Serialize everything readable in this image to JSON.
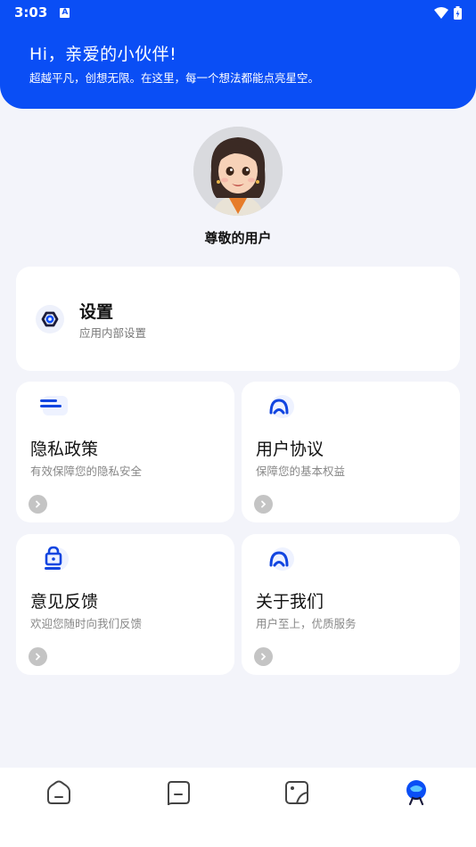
{
  "status_bar": {
    "time": "3:03",
    "notif_letter": "A"
  },
  "header": {
    "greeting": "Hi，亲爱的小伙伴!",
    "subtitle": "超越平凡，创想无限。在这里，每一个想法都能点亮星空。"
  },
  "profile": {
    "username": "尊敬的用户"
  },
  "settings_card": {
    "title": "设置",
    "desc": "应用内部设置"
  },
  "tiles": [
    {
      "title": "隐私政策",
      "desc": "有效保障您的隐私安全",
      "icon": "document-lines-icon"
    },
    {
      "title": "用户协议",
      "desc": "保障您的基本权益",
      "icon": "user-arch-icon"
    },
    {
      "title": "意见反馈",
      "desc": "欢迎您随时向我们反馈",
      "icon": "lock-icon"
    },
    {
      "title": "关于我们",
      "desc": "用户至上，优质服务",
      "icon": "user-arch-icon"
    }
  ],
  "tabbar": {
    "tabs": [
      {
        "icon": "home-icon",
        "active": false
      },
      {
        "icon": "chat-icon",
        "active": false
      },
      {
        "icon": "gallery-icon",
        "active": false
      },
      {
        "icon": "profile-icon",
        "active": true
      }
    ]
  },
  "colors": {
    "brand": "#0a4ef5",
    "background": "#f3f4fa",
    "icon_inactive": "#444444"
  }
}
